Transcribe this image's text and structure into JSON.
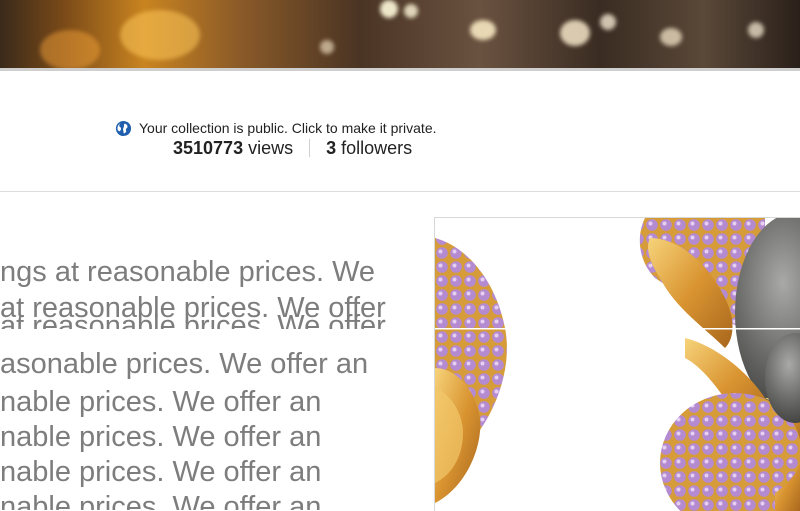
{
  "collection": {
    "privacy_text": "Your collection is public. Click to make it private.",
    "privacy_icon": "globe-icon",
    "views_count": "3510773",
    "views_label": "views",
    "followers_count": "3",
    "followers_label": "followers"
  },
  "description": {
    "lines": [
      "ngs at reasonable prices. We",
      "at reasonable prices. We offer",
      "at reasonable prices. We offer",
      "asonable prices. We offer an",
      "nable prices. We offer an",
      "nable prices. We offer an",
      "nable prices. We offer an",
      "nable prices. We offer an"
    ]
  },
  "colors": {
    "text_gray": "#7d7d7d",
    "gold": "#e0a23a",
    "amethyst": "#b07fc8",
    "pearl": "#6f706e"
  }
}
